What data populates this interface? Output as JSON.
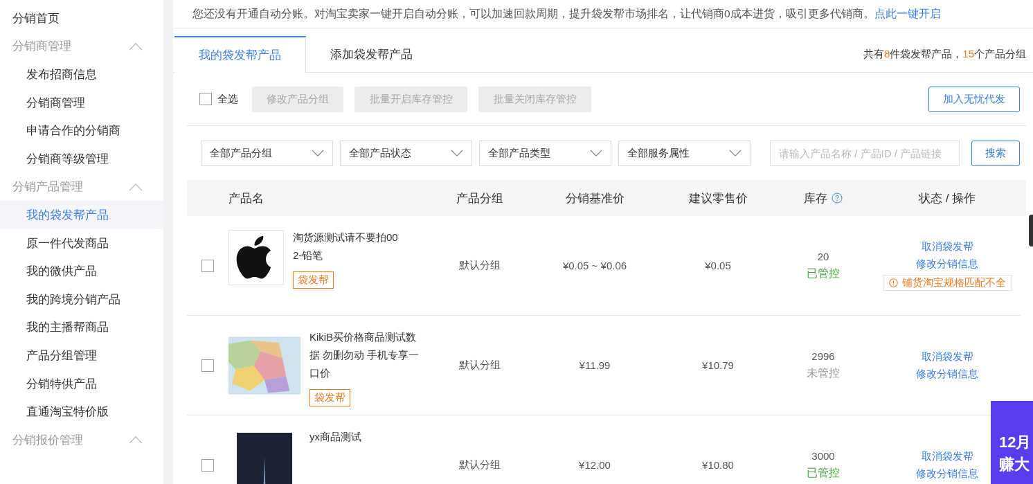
{
  "sidebar": {
    "items": [
      {
        "kind": "link",
        "label": "分销首页",
        "selected": false
      },
      {
        "kind": "group",
        "label": "分销商管理",
        "expanded": true,
        "children": [
          {
            "label": "发布招商信息",
            "selected": false
          },
          {
            "label": "分销商管理",
            "selected": false
          },
          {
            "label": "申请合作的分销商",
            "selected": false
          },
          {
            "label": "分销商等级管理",
            "selected": false
          }
        ]
      },
      {
        "kind": "group",
        "label": "分销产品管理",
        "expanded": true,
        "children": [
          {
            "label": "我的袋发帮产品",
            "selected": true
          },
          {
            "label": "原一件代发商品",
            "selected": false
          },
          {
            "label": "我的微供产品",
            "selected": false
          },
          {
            "label": "我的跨境分销产品",
            "selected": false
          },
          {
            "label": "我的主播帮商品",
            "selected": false
          },
          {
            "label": "产品分组管理",
            "selected": false
          },
          {
            "label": "分销特供产品",
            "selected": false
          },
          {
            "label": "直通淘宝特价版",
            "selected": false
          }
        ]
      },
      {
        "kind": "group",
        "label": "分销报价管理",
        "expanded": true
      }
    ]
  },
  "notice": {
    "text": "您还没有开通自动分账。对淘宝卖家一键开启自动分账，可以加速回款周期，提升袋发帮市场排名，让代销商0成本进货，吸引更多代销商。",
    "link": "点此一键开启"
  },
  "tabs": [
    {
      "label": "我的袋发帮产品",
      "selected": true
    },
    {
      "label": "添加袋发帮产品",
      "selected": false
    }
  ],
  "summary": {
    "prefix": "共有",
    "count": "8",
    "middle": "件袋发帮产品，",
    "groups": "15",
    "suffix": "个产品分组"
  },
  "toolbar": {
    "select_all": {
      "label": "全选",
      "checked": false
    },
    "buttons": [
      {
        "label": "修改产品分组",
        "disabled": true
      },
      {
        "label": "批量开启库存管控",
        "disabled": true
      },
      {
        "label": "批量关闭库存管控",
        "disabled": true
      }
    ],
    "primary": "加入无忧代发"
  },
  "filters": {
    "dropdowns": [
      "全部产品分组",
      "全部产品状态",
      "全部产品类型",
      "全部服务属性"
    ],
    "search": {
      "placeholder": "请输入产品名称 / 产品ID / 产品链接"
    },
    "search_button": "搜索"
  },
  "table": {
    "columns": [
      "产品名",
      "产品分组",
      "分销基准价",
      "建议零售价",
      "库存",
      "状态 / 操作"
    ],
    "rows": [
      {
        "checked": false,
        "name": "淘货源测试请不要拍002-铅笔",
        "tag": "袋发帮",
        "group": "默认分组",
        "base_price": "¥0.05 ~ ¥0.06",
        "retail_price": "¥0.05",
        "stock": "20",
        "stock_status": "已管控",
        "controlled": true,
        "actions": [
          "取消袋发帮",
          "修改分销信息"
        ],
        "warning": "铺货淘宝规格匹配不全"
      },
      {
        "checked": false,
        "name": "KikiB买价格商品测试数据 勿删勿动 手机专享一口价",
        "tag": "袋发帮",
        "group": "默认分组",
        "base_price": "¥11.99",
        "retail_price": "¥10.79",
        "stock": "2996",
        "stock_status": "未管控",
        "controlled": false,
        "actions": [
          "取消袋发帮",
          "修改分销信息"
        ]
      },
      {
        "checked": false,
        "name": "yx商品测试",
        "group": "默认分组",
        "base_price": "¥12.00",
        "retail_price": "¥10.80",
        "stock": "3000",
        "stock_status": "已管控",
        "controlled": true,
        "actions": [
          "取消袋发帮",
          "修改分销信息"
        ]
      }
    ]
  },
  "promo": {
    "lines": [
      "12月",
      "赚大"
    ]
  }
}
